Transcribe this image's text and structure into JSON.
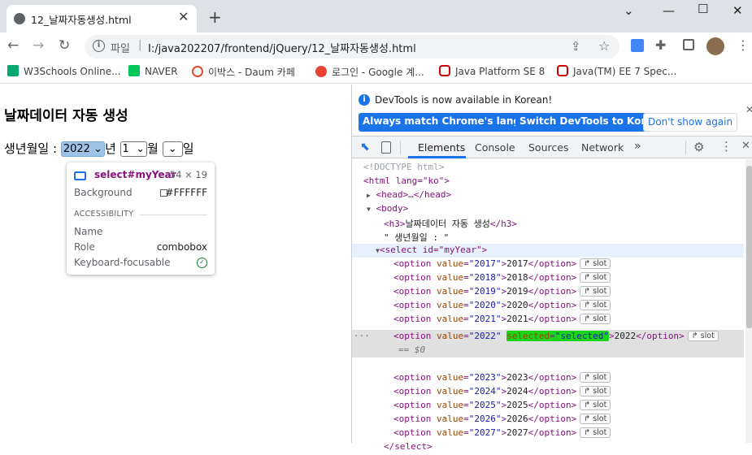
{
  "browser": {
    "tab_title": "12_날짜자동생성.html",
    "scheme_label": "파일",
    "url": "I:/java202207/frontend/jQuery/12_날짜자동생성.html"
  },
  "bookmarks": [
    {
      "label": "W3Schools Online..."
    },
    {
      "label": "NAVER"
    },
    {
      "label": "이박스 - Daum 카페"
    },
    {
      "label": "로그인 - Google 계..."
    },
    {
      "label": "Java Platform SE 8"
    },
    {
      "label": "Java(TM) EE 7 Spec..."
    }
  ],
  "page": {
    "heading": "날짜데이터 자동 생성",
    "birth_label": "생년월일 :",
    "year_value": "2022",
    "year_suffix": "년",
    "month_value": "1",
    "month_suffix": "월",
    "day_suffix": "일"
  },
  "tooltip": {
    "selector": "select#myYear",
    "size": "54 × 19",
    "background_label": "Background",
    "background_value": "#FFFFFF",
    "accessibility_heading": "ACCESSIBILITY",
    "name_label": "Name",
    "role_label": "Role",
    "role_value": "combobox",
    "keyboard_label": "Keyboard-focusable"
  },
  "devtools": {
    "info_text": "DevTools is now available in Korean!",
    "btn_match": "Always match Chrome's language",
    "btn_switch": "Switch DevTools to Korean",
    "btn_dont": "Don't show again",
    "tabs": [
      "Elements",
      "Console",
      "Sources",
      "Network"
    ],
    "more_tabs": "»",
    "doctype": "<!DOCTYPE html>",
    "html_open": "<html lang=\"ko\">",
    "head": "<head>…</head>",
    "body_open": "<body>",
    "h3_line": "날짜데이터 자동 생성",
    "text_node": "\" 생년월일 : \"",
    "select_open": "<select id=\"myYear\">",
    "eq_zero": "== $0",
    "select_close": "</select>",
    "slot_label": "slot",
    "options": [
      "2017",
      "2018",
      "2019",
      "2020",
      "2021",
      "2022",
      "2023",
      "2024",
      "2025",
      "2026",
      "2027"
    ]
  },
  "colors": {
    "accent_blue": "#1a73e8",
    "selected_attr_highlight": "#19d419",
    "tag_color": "#881280",
    "attr_name_color": "#994500",
    "attr_value_color": "#1a1aa6"
  }
}
